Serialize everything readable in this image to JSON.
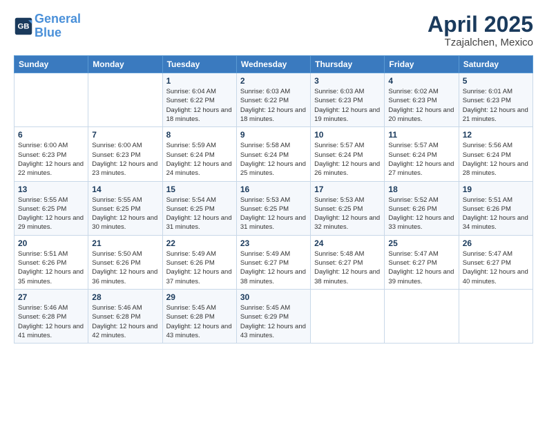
{
  "header": {
    "logo_line1": "General",
    "logo_line2": "Blue",
    "month_title": "April 2025",
    "subtitle": "Tzajalchen, Mexico"
  },
  "weekdays": [
    "Sunday",
    "Monday",
    "Tuesday",
    "Wednesday",
    "Thursday",
    "Friday",
    "Saturday"
  ],
  "weeks": [
    [
      {
        "day": "",
        "info": ""
      },
      {
        "day": "",
        "info": ""
      },
      {
        "day": "1",
        "info": "Sunrise: 6:04 AM\nSunset: 6:22 PM\nDaylight: 12 hours and 18 minutes."
      },
      {
        "day": "2",
        "info": "Sunrise: 6:03 AM\nSunset: 6:22 PM\nDaylight: 12 hours and 18 minutes."
      },
      {
        "day": "3",
        "info": "Sunrise: 6:03 AM\nSunset: 6:23 PM\nDaylight: 12 hours and 19 minutes."
      },
      {
        "day": "4",
        "info": "Sunrise: 6:02 AM\nSunset: 6:23 PM\nDaylight: 12 hours and 20 minutes."
      },
      {
        "day": "5",
        "info": "Sunrise: 6:01 AM\nSunset: 6:23 PM\nDaylight: 12 hours and 21 minutes."
      }
    ],
    [
      {
        "day": "6",
        "info": "Sunrise: 6:00 AM\nSunset: 6:23 PM\nDaylight: 12 hours and 22 minutes."
      },
      {
        "day": "7",
        "info": "Sunrise: 6:00 AM\nSunset: 6:23 PM\nDaylight: 12 hours and 23 minutes."
      },
      {
        "day": "8",
        "info": "Sunrise: 5:59 AM\nSunset: 6:24 PM\nDaylight: 12 hours and 24 minutes."
      },
      {
        "day": "9",
        "info": "Sunrise: 5:58 AM\nSunset: 6:24 PM\nDaylight: 12 hours and 25 minutes."
      },
      {
        "day": "10",
        "info": "Sunrise: 5:57 AM\nSunset: 6:24 PM\nDaylight: 12 hours and 26 minutes."
      },
      {
        "day": "11",
        "info": "Sunrise: 5:57 AM\nSunset: 6:24 PM\nDaylight: 12 hours and 27 minutes."
      },
      {
        "day": "12",
        "info": "Sunrise: 5:56 AM\nSunset: 6:24 PM\nDaylight: 12 hours and 28 minutes."
      }
    ],
    [
      {
        "day": "13",
        "info": "Sunrise: 5:55 AM\nSunset: 6:25 PM\nDaylight: 12 hours and 29 minutes."
      },
      {
        "day": "14",
        "info": "Sunrise: 5:55 AM\nSunset: 6:25 PM\nDaylight: 12 hours and 30 minutes."
      },
      {
        "day": "15",
        "info": "Sunrise: 5:54 AM\nSunset: 6:25 PM\nDaylight: 12 hours and 31 minutes."
      },
      {
        "day": "16",
        "info": "Sunrise: 5:53 AM\nSunset: 6:25 PM\nDaylight: 12 hours and 31 minutes."
      },
      {
        "day": "17",
        "info": "Sunrise: 5:53 AM\nSunset: 6:25 PM\nDaylight: 12 hours and 32 minutes."
      },
      {
        "day": "18",
        "info": "Sunrise: 5:52 AM\nSunset: 6:26 PM\nDaylight: 12 hours and 33 minutes."
      },
      {
        "day": "19",
        "info": "Sunrise: 5:51 AM\nSunset: 6:26 PM\nDaylight: 12 hours and 34 minutes."
      }
    ],
    [
      {
        "day": "20",
        "info": "Sunrise: 5:51 AM\nSunset: 6:26 PM\nDaylight: 12 hours and 35 minutes."
      },
      {
        "day": "21",
        "info": "Sunrise: 5:50 AM\nSunset: 6:26 PM\nDaylight: 12 hours and 36 minutes."
      },
      {
        "day": "22",
        "info": "Sunrise: 5:49 AM\nSunset: 6:26 PM\nDaylight: 12 hours and 37 minutes."
      },
      {
        "day": "23",
        "info": "Sunrise: 5:49 AM\nSunset: 6:27 PM\nDaylight: 12 hours and 38 minutes."
      },
      {
        "day": "24",
        "info": "Sunrise: 5:48 AM\nSunset: 6:27 PM\nDaylight: 12 hours and 38 minutes."
      },
      {
        "day": "25",
        "info": "Sunrise: 5:47 AM\nSunset: 6:27 PM\nDaylight: 12 hours and 39 minutes."
      },
      {
        "day": "26",
        "info": "Sunrise: 5:47 AM\nSunset: 6:27 PM\nDaylight: 12 hours and 40 minutes."
      }
    ],
    [
      {
        "day": "27",
        "info": "Sunrise: 5:46 AM\nSunset: 6:28 PM\nDaylight: 12 hours and 41 minutes."
      },
      {
        "day": "28",
        "info": "Sunrise: 5:46 AM\nSunset: 6:28 PM\nDaylight: 12 hours and 42 minutes."
      },
      {
        "day": "29",
        "info": "Sunrise: 5:45 AM\nSunset: 6:28 PM\nDaylight: 12 hours and 43 minutes."
      },
      {
        "day": "30",
        "info": "Sunrise: 5:45 AM\nSunset: 6:29 PM\nDaylight: 12 hours and 43 minutes."
      },
      {
        "day": "",
        "info": ""
      },
      {
        "day": "",
        "info": ""
      },
      {
        "day": "",
        "info": ""
      }
    ]
  ]
}
